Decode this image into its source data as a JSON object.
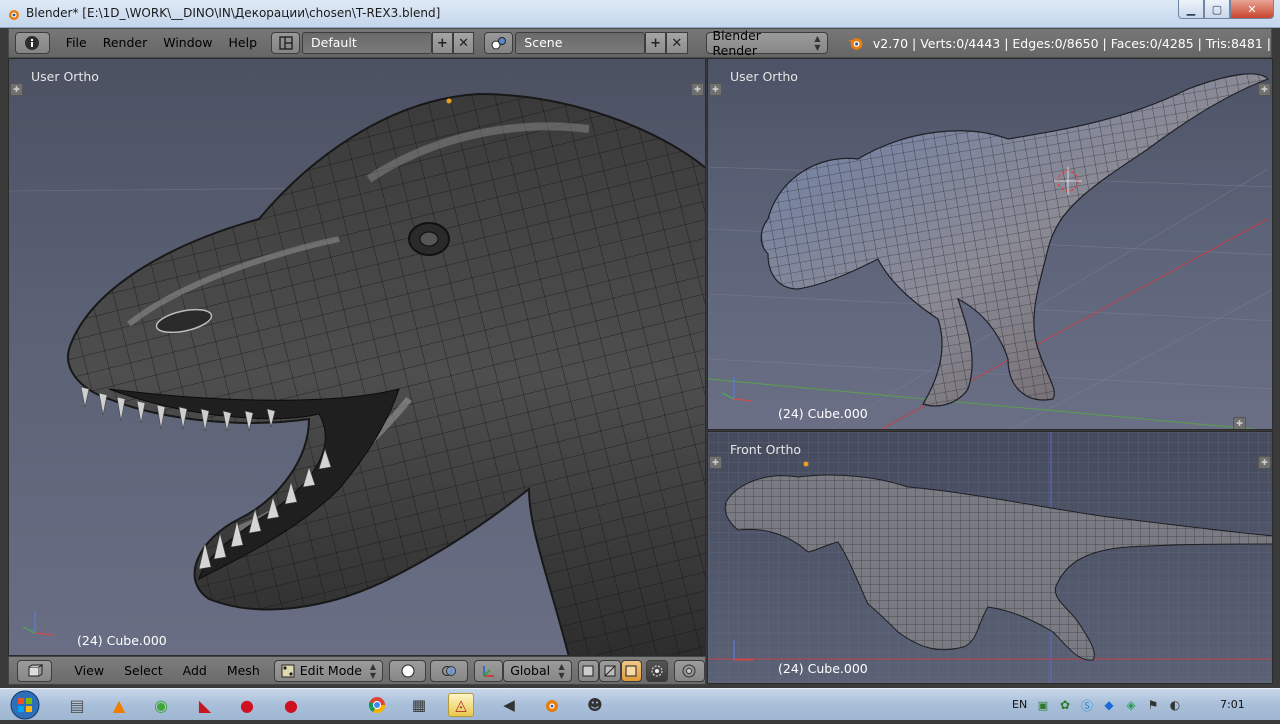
{
  "window": {
    "title": "Blender* [E:\\1D_\\WORK\\__DINO\\IN\\Декорации\\chosen\\T-REX3.blend]",
    "buttons": [
      "minimize",
      "maximize",
      "close"
    ]
  },
  "infobar": {
    "menus": [
      "File",
      "Render",
      "Window",
      "Help"
    ],
    "screen_layout": "Default",
    "scene": "Scene",
    "render_engine": "Blender Render",
    "stats": "v2.70 | Verts:0/4443 | Edges:0/8650 | Faces:0/4285 | Tris:8481 |"
  },
  "viewports": {
    "main": {
      "label": "User Ortho",
      "object": "(24) Cube.000"
    },
    "right_top": {
      "label": "User Ortho",
      "object": "(24) Cube.000"
    },
    "right_bottom": {
      "label": "Front Ortho",
      "object": "(24) Cube.000"
    }
  },
  "view_header": {
    "menus": [
      "View",
      "Select",
      "Add",
      "Mesh"
    ],
    "mode": "Edit Mode",
    "orientation": "Global"
  },
  "taskbar": {
    "language": "EN",
    "clock": "7:01"
  },
  "colors": {
    "accent_orange": "#e87d0d",
    "viewport_bg": "#5b6275",
    "header_gray": "#777777"
  }
}
